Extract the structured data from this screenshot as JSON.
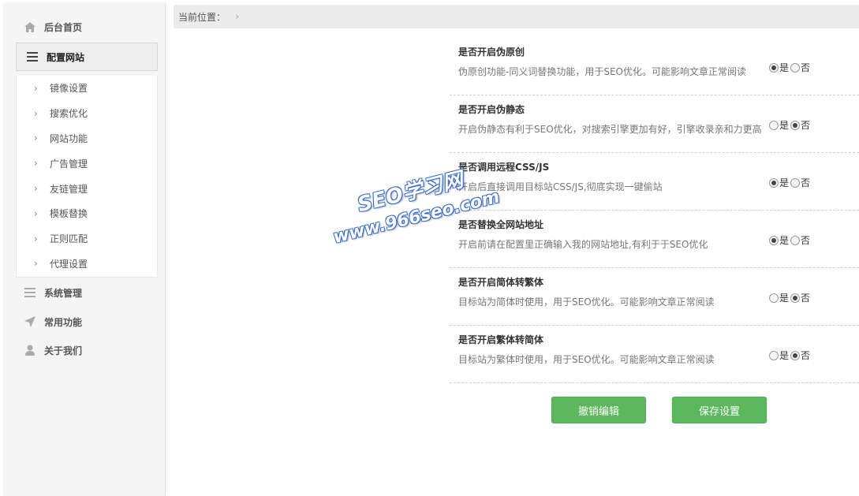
{
  "sidebar": {
    "home_label": "后台首页",
    "config_label": "配置网站",
    "sub_items": [
      "镜像设置",
      "搜索优化",
      "网站功能",
      "广告管理",
      "友链管理",
      "模板替换",
      "正则匹配",
      "代理设置"
    ],
    "system_label": "系统管理",
    "common_label": "常用功能",
    "about_label": "关于我们"
  },
  "topbar": {
    "breadcrumb_label": "当前位置："
  },
  "settings": [
    {
      "title": "是否开启伪原创",
      "desc": "伪原创功能-同义词替换功能，用于SEO优化。可能影响文章正常阅读",
      "selected": "yes"
    },
    {
      "title": "是否开启伪静态",
      "desc": "开启伪静态有利于SEO优化，对搜索引擎更加有好，引擎收录亲和力更高",
      "selected": "no"
    },
    {
      "title": "是否调用远程CSS/JS",
      "desc": "开启后直接调用目标站CSS/JS,彻底实现一键偷站",
      "selected": "yes"
    },
    {
      "title": "是否替换全网站地址",
      "desc": "开启前请在配置里正确输入我的网站地址,有利于于SEO优化",
      "selected": "yes"
    },
    {
      "title": "是否开启简体转繁体",
      "desc": "目标站为简体时使用，用于SEO优化。可能影响文章正常阅读",
      "selected": "no"
    },
    {
      "title": "是否开启繁体转简体",
      "desc": "目标站为繁体时使用，用于SEO优化。可能影响文章正常阅读",
      "selected": "no"
    }
  ],
  "radio_labels": {
    "yes": "是",
    "no": "否"
  },
  "buttons": {
    "cancel": "撤销编辑",
    "save": "保存设置"
  },
  "watermark": {
    "line1": "SEO学习网",
    "line2": "www.966seo.com"
  }
}
